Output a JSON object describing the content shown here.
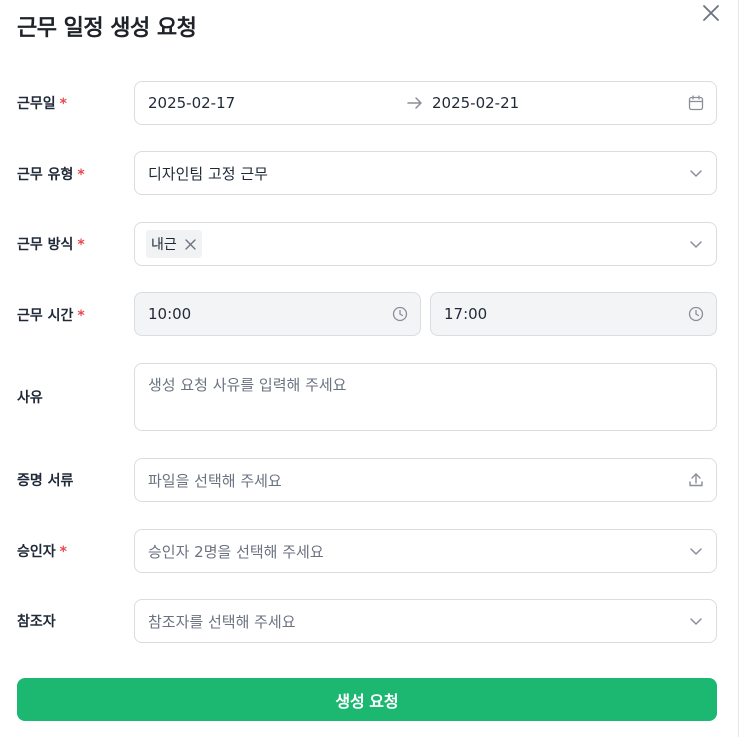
{
  "dialog": {
    "title": "근무 일정 생성 요청"
  },
  "form": {
    "required_mark": "*",
    "work_date": {
      "label": "근무일",
      "start": "2025-02-17",
      "end": "2025-02-21"
    },
    "work_type": {
      "label": "근무 유형",
      "value": "디자인팀 고정 근무"
    },
    "work_method": {
      "label": "근무 방식",
      "tags": [
        "내근"
      ]
    },
    "work_time": {
      "label": "근무 시간",
      "start": "10:00",
      "end": "17:00"
    },
    "reason": {
      "label": "사유",
      "placeholder": "생성 요청 사유를 입력해 주세요"
    },
    "proof_docs": {
      "label": "증명 서류",
      "placeholder": "파일을 선택해 주세요"
    },
    "approver": {
      "label": "승인자",
      "placeholder": "승인자 2명을 선택해 주세요"
    },
    "reference": {
      "label": "참조자",
      "placeholder": "참조자를 선택해 주세요"
    }
  },
  "actions": {
    "submit_label": "생성 요청"
  },
  "colors": {
    "accent": "#1cb872",
    "required": "#e5484d",
    "border": "#d9dce1",
    "disabled_bg": "#f3f4f6"
  },
  "icons": [
    "close-icon",
    "arrow-right-icon",
    "calendar-icon",
    "chevron-down-icon",
    "tag-remove-icon",
    "clock-icon",
    "upload-icon"
  ]
}
